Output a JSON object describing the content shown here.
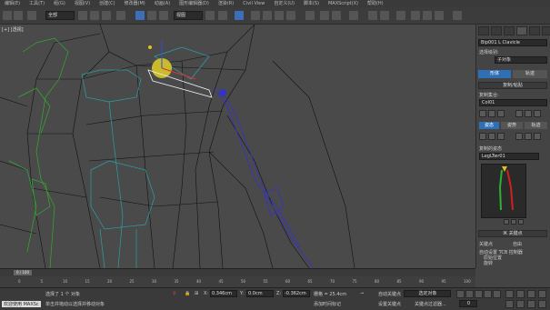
{
  "menu": [
    "编辑(E)",
    "工具(T)",
    "组(G)",
    "视图(V)",
    "创建(C)",
    "修改器(M)",
    "动画(A)",
    "图形编辑器(D)",
    "渲染(R)",
    "Civil View",
    "自定义(U)",
    "脚本(S)",
    "MAXScript(X)",
    "帮助(H)"
  ],
  "toolbar": {
    "selection_filter": "全部",
    "ref_coord": "视图"
  },
  "viewport": {
    "label": "[+] [透视]"
  },
  "command_panel": {
    "object_name": "Bip001 L Clavicle",
    "selection_sets_label": "选择级别:",
    "selection_set_value": "子对象",
    "tab_track_label": "轨迹",
    "tab_body_label": "形体",
    "rollout_copy_paste": "复制/粘贴",
    "copy_collection_label": "复制集合:",
    "collection_value": "Col01",
    "tab_posture": "姿态",
    "tab_track": "轨迹",
    "tab_pose": "姿势",
    "copied_poses_label": "复制的姿态",
    "pose_value": "LegLTwr01",
    "rollout_ik": "IK 关键点",
    "ik_label": "关键点",
    "auto_key_label": "自由",
    "flip_label": "自动设置 TCB 控制器",
    "radio1": "原始位置",
    "radio2": "旋转",
    "radio3": "旋转"
  },
  "timeline": {
    "frame": "0 / 100"
  },
  "ruler_ticks": [
    "0",
    "5",
    "10",
    "15",
    "20",
    "25",
    "30",
    "35",
    "40",
    "45",
    "50",
    "55",
    "60",
    "65",
    "70",
    "75",
    "80",
    "85",
    "90",
    "95",
    "100"
  ],
  "status": {
    "selected": "选择了 1 个 对象",
    "hint": "单击并拖动以选择并移动对象",
    "x_label": "X:",
    "x_value": "0.346cm",
    "y_label": "Y:",
    "y_value": "0.0cm",
    "z_label": "Z:",
    "z_value": "-0.362cm",
    "grid": "栅格 = 25.4cm",
    "add_time_tag": "添加时间标记",
    "auto_key": "自动关键点",
    "set_key": "设置关键点",
    "selected_filter": "选定对象",
    "key_filters": "关键点过滤器...",
    "frame_value": "0",
    "welcome": "欢迎使用 MAXSc"
  }
}
